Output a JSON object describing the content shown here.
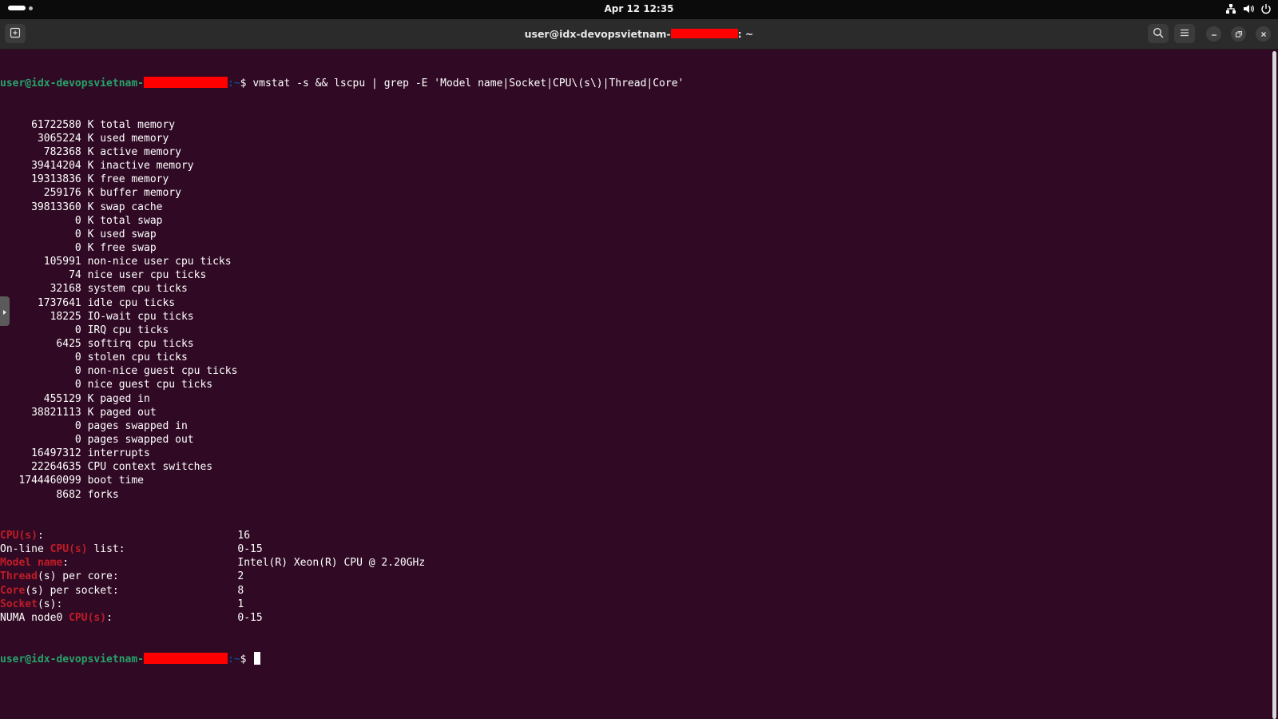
{
  "top_panel": {
    "clock": "Apr 12  12:35",
    "icons": [
      "network-icon",
      "volume-icon",
      "power-icon"
    ]
  },
  "window": {
    "title_prefix": "user@idx-devopsvietnam-",
    "title_suffix": ": ~",
    "buttons": [
      "new-tab-icon",
      "search-icon",
      "hamburger-menu-icon",
      "minimize-icon",
      "restore-icon",
      "close-icon"
    ]
  },
  "colors": {
    "terminal_bg": "#300a24",
    "prompt_user": "#26a269",
    "prompt_path": "#12488b",
    "grep_highlight": "#c01c28",
    "redaction": "#ff0000"
  },
  "terminal": {
    "prompt_user": "user@idx-devopsvietnam-",
    "prompt_path": ":~",
    "prompt_symbol": "$ ",
    "command": "vmstat -s && lscpu | grep -E 'Model name|Socket|CPU\\(s\\)|Thread|Core'",
    "vmstat": [
      {
        "value": "61722580",
        "label": "K total memory"
      },
      {
        "value": "3065224",
        "label": "K used memory"
      },
      {
        "value": "782368",
        "label": "K active memory"
      },
      {
        "value": "39414204",
        "label": "K inactive memory"
      },
      {
        "value": "19313836",
        "label": "K free memory"
      },
      {
        "value": "259176",
        "label": "K buffer memory"
      },
      {
        "value": "39813360",
        "label": "K swap cache"
      },
      {
        "value": "0",
        "label": "K total swap"
      },
      {
        "value": "0",
        "label": "K used swap"
      },
      {
        "value": "0",
        "label": "K free swap"
      },
      {
        "value": "105991",
        "label": "non-nice user cpu ticks"
      },
      {
        "value": "74",
        "label": "nice user cpu ticks"
      },
      {
        "value": "32168",
        "label": "system cpu ticks"
      },
      {
        "value": "1737641",
        "label": "idle cpu ticks"
      },
      {
        "value": "18225",
        "label": "IO-wait cpu ticks"
      },
      {
        "value": "0",
        "label": "IRQ cpu ticks"
      },
      {
        "value": "6425",
        "label": "softirq cpu ticks"
      },
      {
        "value": "0",
        "label": "stolen cpu ticks"
      },
      {
        "value": "0",
        "label": "non-nice guest cpu ticks"
      },
      {
        "value": "0",
        "label": "nice guest cpu ticks"
      },
      {
        "value": "455129",
        "label": "K paged in"
      },
      {
        "value": "38821113",
        "label": "K paged out"
      },
      {
        "value": "0",
        "label": "pages swapped in"
      },
      {
        "value": "0",
        "label": "pages swapped out"
      },
      {
        "value": "16497312",
        "label": "interrupts"
      },
      {
        "value": "22264635",
        "label": "CPU context switches"
      },
      {
        "value": "1744460099",
        "label": "boot time"
      },
      {
        "value": "8682",
        "label": "forks"
      }
    ],
    "lscpu": [
      {
        "pre": "",
        "hl": "CPU(s)",
        "post": ":",
        "value": "16"
      },
      {
        "pre": "On-line ",
        "hl": "CPU(s)",
        "post": " list:",
        "value": "0-15"
      },
      {
        "pre": "",
        "hl": "Model name",
        "post": ":",
        "value": "Intel(R) Xeon(R) CPU @ 2.20GHz"
      },
      {
        "pre": "",
        "hl": "Thread",
        "post": "(s) per core:",
        "value": "2"
      },
      {
        "pre": "",
        "hl": "Core",
        "post": "(s) per socket:",
        "value": "8"
      },
      {
        "pre": "",
        "hl": "Socket",
        "post": "(s):",
        "value": "1"
      },
      {
        "pre": "NUMA node0 ",
        "hl": "CPU(s)",
        "post": ":",
        "value": "0-15"
      }
    ]
  }
}
